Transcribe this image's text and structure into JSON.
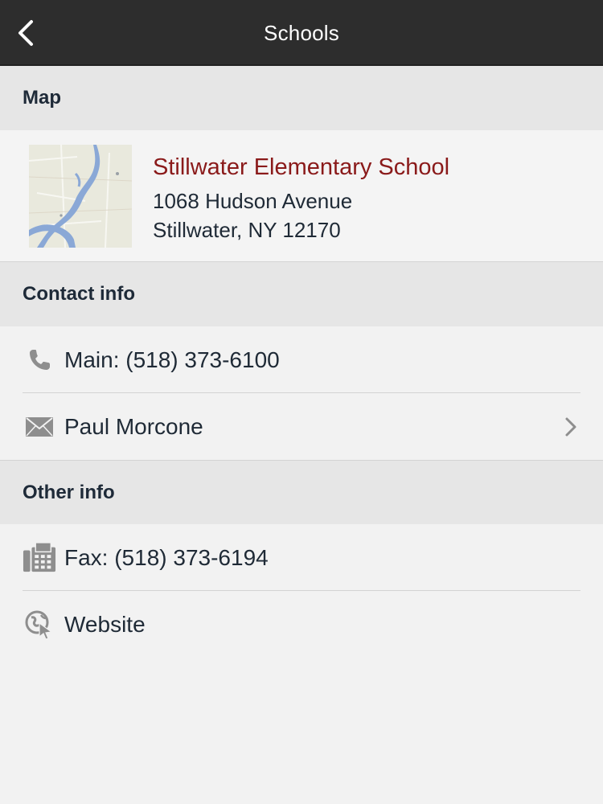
{
  "header": {
    "title": "Schools"
  },
  "map_section": {
    "header": "Map",
    "school_name": "Stillwater Elementary School",
    "address_line1": "1068 Hudson Avenue",
    "address_line2": "Stillwater, NY 12170",
    "thumbnail_icon": "map-thumbnail"
  },
  "contact_section": {
    "header": "Contact info",
    "items": [
      {
        "icon": "phone-icon",
        "label": "Main: (518) 373-6100",
        "has_chevron": false
      },
      {
        "icon": "envelope-icon",
        "label": "Paul Morcone",
        "has_chevron": true
      }
    ]
  },
  "other_section": {
    "header": "Other info",
    "items": [
      {
        "icon": "fax-icon",
        "label": "Fax: (518) 373-6194",
        "has_chevron": false
      },
      {
        "icon": "globe-cursor-icon",
        "label": "Website",
        "has_chevron": false
      }
    ]
  },
  "colors": {
    "topbar": "#2d2d2d",
    "section_bg": "#e6e6e6",
    "body_bg": "#f2f2f2",
    "school_name": "#8a1a1a",
    "text": "#1f2a36"
  }
}
